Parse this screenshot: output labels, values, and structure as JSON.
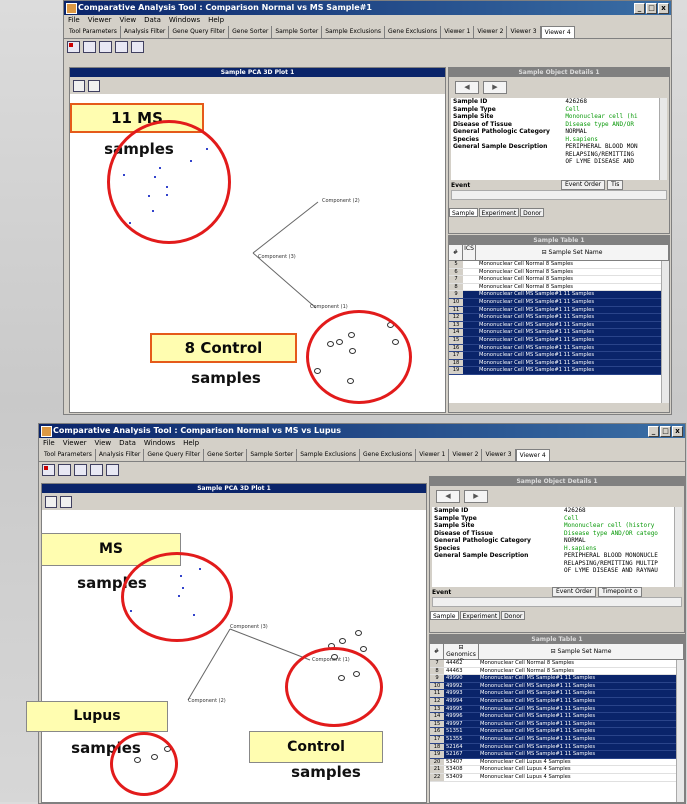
{
  "top": {
    "title": "Comparative Analysis Tool : Comparison Normal vs MS Sample#1",
    "menus": [
      "File",
      "Viewer",
      "View",
      "Data",
      "Windows",
      "Help"
    ],
    "tabs": [
      "Tool Parameters",
      "Analysis Filter",
      "Gene Query Filter",
      "Gene Sorter",
      "Sample Sorter",
      "Sample Exclusions",
      "Gene Exclusions",
      "Viewer 1",
      "Viewer 2",
      "Viewer 3",
      "Viewer 4"
    ],
    "plot_title": "Sample PCA 3D Plot 1",
    "axis_labels": [
      "Component (2)",
      "Component (3)",
      "Component (1)"
    ],
    "detail_title": "Sample Object Details 1",
    "detail_rows": [
      {
        "key": "Sample ID",
        "value": "426268"
      },
      {
        "key": "Sample Type",
        "value": "Cell"
      },
      {
        "key": "Sample Site",
        "value": "Mononuclear cell (hi"
      },
      {
        "key": "Disease of Tissue",
        "value": "Disease type AND/OR"
      },
      {
        "key": "General Pathologic Category",
        "value": "NORMAL"
      },
      {
        "key": "Species",
        "value": "H.sapiens"
      },
      {
        "key": "General Sample Description",
        "value": "PERIPHERAL BLOOD MON"
      },
      {
        "key": "",
        "value": "RELAPSING/REMITTING"
      },
      {
        "key": "",
        "value": "OF LYME DISEASE AND"
      }
    ],
    "event_label": "Event",
    "event_buttons": [
      "Event Order",
      "Tis"
    ],
    "sub_tabs": [
      "Sample",
      "Experiment",
      "Donor"
    ],
    "table_title": "Sample Table 1",
    "table_headers": [
      "#",
      "ICS",
      "Sample Set Name"
    ],
    "rows": [
      {
        "n": "5",
        "name": "Mononuclear Cell Normal 8 Samples",
        "sel": false
      },
      {
        "n": "6",
        "name": "Mononuclear Cell Normal 8 Samples",
        "sel": false
      },
      {
        "n": "7",
        "name": "Mononuclear Cell Normal 8 Samples",
        "sel": false
      },
      {
        "n": "8",
        "name": "Mononuclear Cell Normal 8 Samples",
        "sel": false
      },
      {
        "n": "9",
        "name": "Mononuclear Cell MS Sample#1 11 Samples",
        "sel": true
      },
      {
        "n": "10",
        "name": "Mononuclear Cell MS Sample#1 11 Samples",
        "sel": true
      },
      {
        "n": "11",
        "name": "Mononuclear Cell MS Sample#1 11 Samples",
        "sel": true
      },
      {
        "n": "12",
        "name": "Mononuclear Cell MS Sample#1 11 Samples",
        "sel": true
      },
      {
        "n": "13",
        "name": "Mononuclear Cell MS Sample#1 11 Samples",
        "sel": true
      },
      {
        "n": "14",
        "name": "Mononuclear Cell MS Sample#1 11 Samples",
        "sel": true
      },
      {
        "n": "15",
        "name": "Mononuclear Cell MS Sample#1 11 Samples",
        "sel": true
      },
      {
        "n": "16",
        "name": "Mononuclear Cell MS Sample#1 11 Samples",
        "sel": true
      },
      {
        "n": "17",
        "name": "Mononuclear Cell MS Sample#1 11 Samples",
        "sel": true
      },
      {
        "n": "18",
        "name": "Mononuclear Cell MS Sample#1 11 Samples",
        "sel": true
      },
      {
        "n": "19",
        "name": "Mononuclear Cell MS Sample#1 11 Samples",
        "sel": true
      }
    ],
    "annotations": {
      "ms_box": "11 MS",
      "ms_text": "samples",
      "control_box": "8 Control",
      "control_text": "samples"
    }
  },
  "bottom": {
    "title": "Comparative Analysis Tool : Comparison Normal vs MS vs Lupus",
    "menus": [
      "File",
      "Viewer",
      "View",
      "Data",
      "Windows",
      "Help"
    ],
    "tabs": [
      "Tool Parameters",
      "Analysis Filter",
      "Gene Query Filter",
      "Gene Sorter",
      "Sample Sorter",
      "Sample Exclusions",
      "Gene Exclusions",
      "Viewer 1",
      "Viewer 2",
      "Viewer 3",
      "Viewer 4"
    ],
    "plot_title": "Sample PCA 3D Plot 1",
    "axis_labels": [
      "Component (3)",
      "Component (1)",
      "Component (2)"
    ],
    "detail_title": "Sample Object Details 1",
    "detail_rows": [
      {
        "key": "Sample ID",
        "value": "426268"
      },
      {
        "key": "Sample Type",
        "value": "Cell"
      },
      {
        "key": "Sample Site",
        "value": "Mononuclear cell (history"
      },
      {
        "key": "Disease of Tissue",
        "value": "Disease type AND/OR catego"
      },
      {
        "key": "General Pathologic Category",
        "value": "NORMAL"
      },
      {
        "key": "Species",
        "value": "H.sapiens"
      },
      {
        "key": "General Sample Description",
        "value": "PERIPHERAL BLOOD MONONUCLE"
      },
      {
        "key": "",
        "value": "RELAPSING/REMITTING MULTIP"
      },
      {
        "key": "",
        "value": "OF LYME DISEASE AND RAYNAU"
      }
    ],
    "event_label": "Event",
    "event_buttons": [
      "Event Order",
      "Timepoint o"
    ],
    "sub_tabs": [
      "Sample",
      "Experiment",
      "Donor"
    ],
    "table_title": "Sample Table 1",
    "table_headers": [
      "#",
      "Genomics ID",
      "Sample Set Name"
    ],
    "rows": [
      {
        "n": "7",
        "id": "44462",
        "name": "Mononuclear Cell Normal 8 Samples",
        "sel": false
      },
      {
        "n": "8",
        "id": "44463",
        "name": "Mononuclear Cell Normal 8 Samples",
        "sel": false
      },
      {
        "n": "9",
        "id": "49990",
        "name": "Mononuclear Cell MS Sample#1 11 Samples",
        "sel": true
      },
      {
        "n": "10",
        "id": "49992",
        "name": "Mononuclear Cell MS Sample#1 11 Samples",
        "sel": true
      },
      {
        "n": "11",
        "id": "49993",
        "name": "Mononuclear Cell MS Sample#1 11 Samples",
        "sel": true
      },
      {
        "n": "12",
        "id": "49994",
        "name": "Mononuclear Cell MS Sample#1 11 Samples",
        "sel": true
      },
      {
        "n": "13",
        "id": "49995",
        "name": "Mononuclear Cell MS Sample#1 11 Samples",
        "sel": true
      },
      {
        "n": "14",
        "id": "49996",
        "name": "Mononuclear Cell MS Sample#1 11 Samples",
        "sel": true
      },
      {
        "n": "15",
        "id": "49997",
        "name": "Mononuclear Cell MS Sample#1 11 Samples",
        "sel": true
      },
      {
        "n": "16",
        "id": "51351",
        "name": "Mononuclear Cell MS Sample#1 11 Samples",
        "sel": true
      },
      {
        "n": "17",
        "id": "51355",
        "name": "Mononuclear Cell MS Sample#1 11 Samples",
        "sel": true
      },
      {
        "n": "18",
        "id": "52164",
        "name": "Mononuclear Cell MS Sample#1 11 Samples",
        "sel": true
      },
      {
        "n": "19",
        "id": "52167",
        "name": "Mononuclear Cell MS Sample#1 11 Samples",
        "sel": true
      },
      {
        "n": "20",
        "id": "53407",
        "name": "Mononuclear Cell Lupus 4 Samples",
        "sel": false
      },
      {
        "n": "21",
        "id": "53408",
        "name": "Mononuclear Cell Lupus 4 Samples",
        "sel": false
      },
      {
        "n": "22",
        "id": "53409",
        "name": "Mononuclear Cell Lupus 4 Samples",
        "sel": false
      }
    ],
    "annotations": {
      "ms_box": "MS",
      "ms_text": "samples",
      "lupus_box": "Lupus",
      "lupus_text": "samples",
      "control_box": "Control",
      "control_text": "samples"
    }
  },
  "colors": {
    "accent": "#0a246a",
    "highlight": "#fffdb0",
    "circle": "#e21b1b",
    "box_border": "#e55a1a"
  }
}
